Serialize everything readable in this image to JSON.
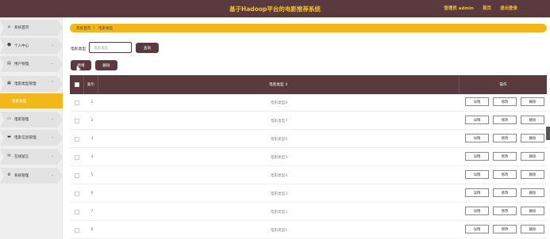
{
  "header": {
    "title": "基于Hadoop平台的电影推荐系统",
    "user": "管理员 admin",
    "home": "首页",
    "logout": "退出登录"
  },
  "sidebar": {
    "items": [
      {
        "label": "系统首页",
        "icon": "home-icon",
        "glyph": "⌂"
      },
      {
        "label": "个人中心",
        "icon": "user-icon",
        "glyph": "☻"
      },
      {
        "label": "用户管理",
        "icon": "users-icon",
        "glyph": "▤"
      },
      {
        "label": "电影类型管理",
        "icon": "grid-icon",
        "glyph": "▦"
      },
      {
        "label": "电影管理",
        "icon": "film-icon",
        "glyph": "▭"
      },
      {
        "label": "电影信息管理",
        "icon": "card-icon",
        "glyph": "▬"
      },
      {
        "label": "在线留言",
        "icon": "message-icon",
        "glyph": "✉"
      },
      {
        "label": "系统管理",
        "icon": "gear-icon",
        "glyph": "⚙"
      }
    ],
    "active_sub": "电影类型"
  },
  "breadcrumb": {
    "home": "系统首页",
    "sep": "|",
    "current": "电影类型"
  },
  "search": {
    "label": "电影类型",
    "placeholder": "电影类型",
    "button": "查询"
  },
  "actions": {
    "add": "新增",
    "delete": "删除"
  },
  "table": {
    "headers": {
      "index": "索引",
      "type": "电影类型 ⇕",
      "ops": "操作"
    },
    "rows": [
      {
        "index": "1",
        "type": "电影类型8"
      },
      {
        "index": "2",
        "type": "电影类型7"
      },
      {
        "index": "3",
        "type": "电影类型6"
      },
      {
        "index": "4",
        "type": "电影类型5"
      },
      {
        "index": "5",
        "type": "电影类型4"
      },
      {
        "index": "6",
        "type": "电影类型3"
      },
      {
        "index": "7",
        "type": "电影类型2"
      },
      {
        "index": "8",
        "type": "电影类型1"
      }
    ],
    "row_buttons": {
      "detail": "详情",
      "edit": "修改",
      "delete": "删除"
    }
  },
  "colors": {
    "brand_dark": "#5a3a3f",
    "accent_yellow": "#f1b81c",
    "title_yellow": "#f2c232"
  }
}
